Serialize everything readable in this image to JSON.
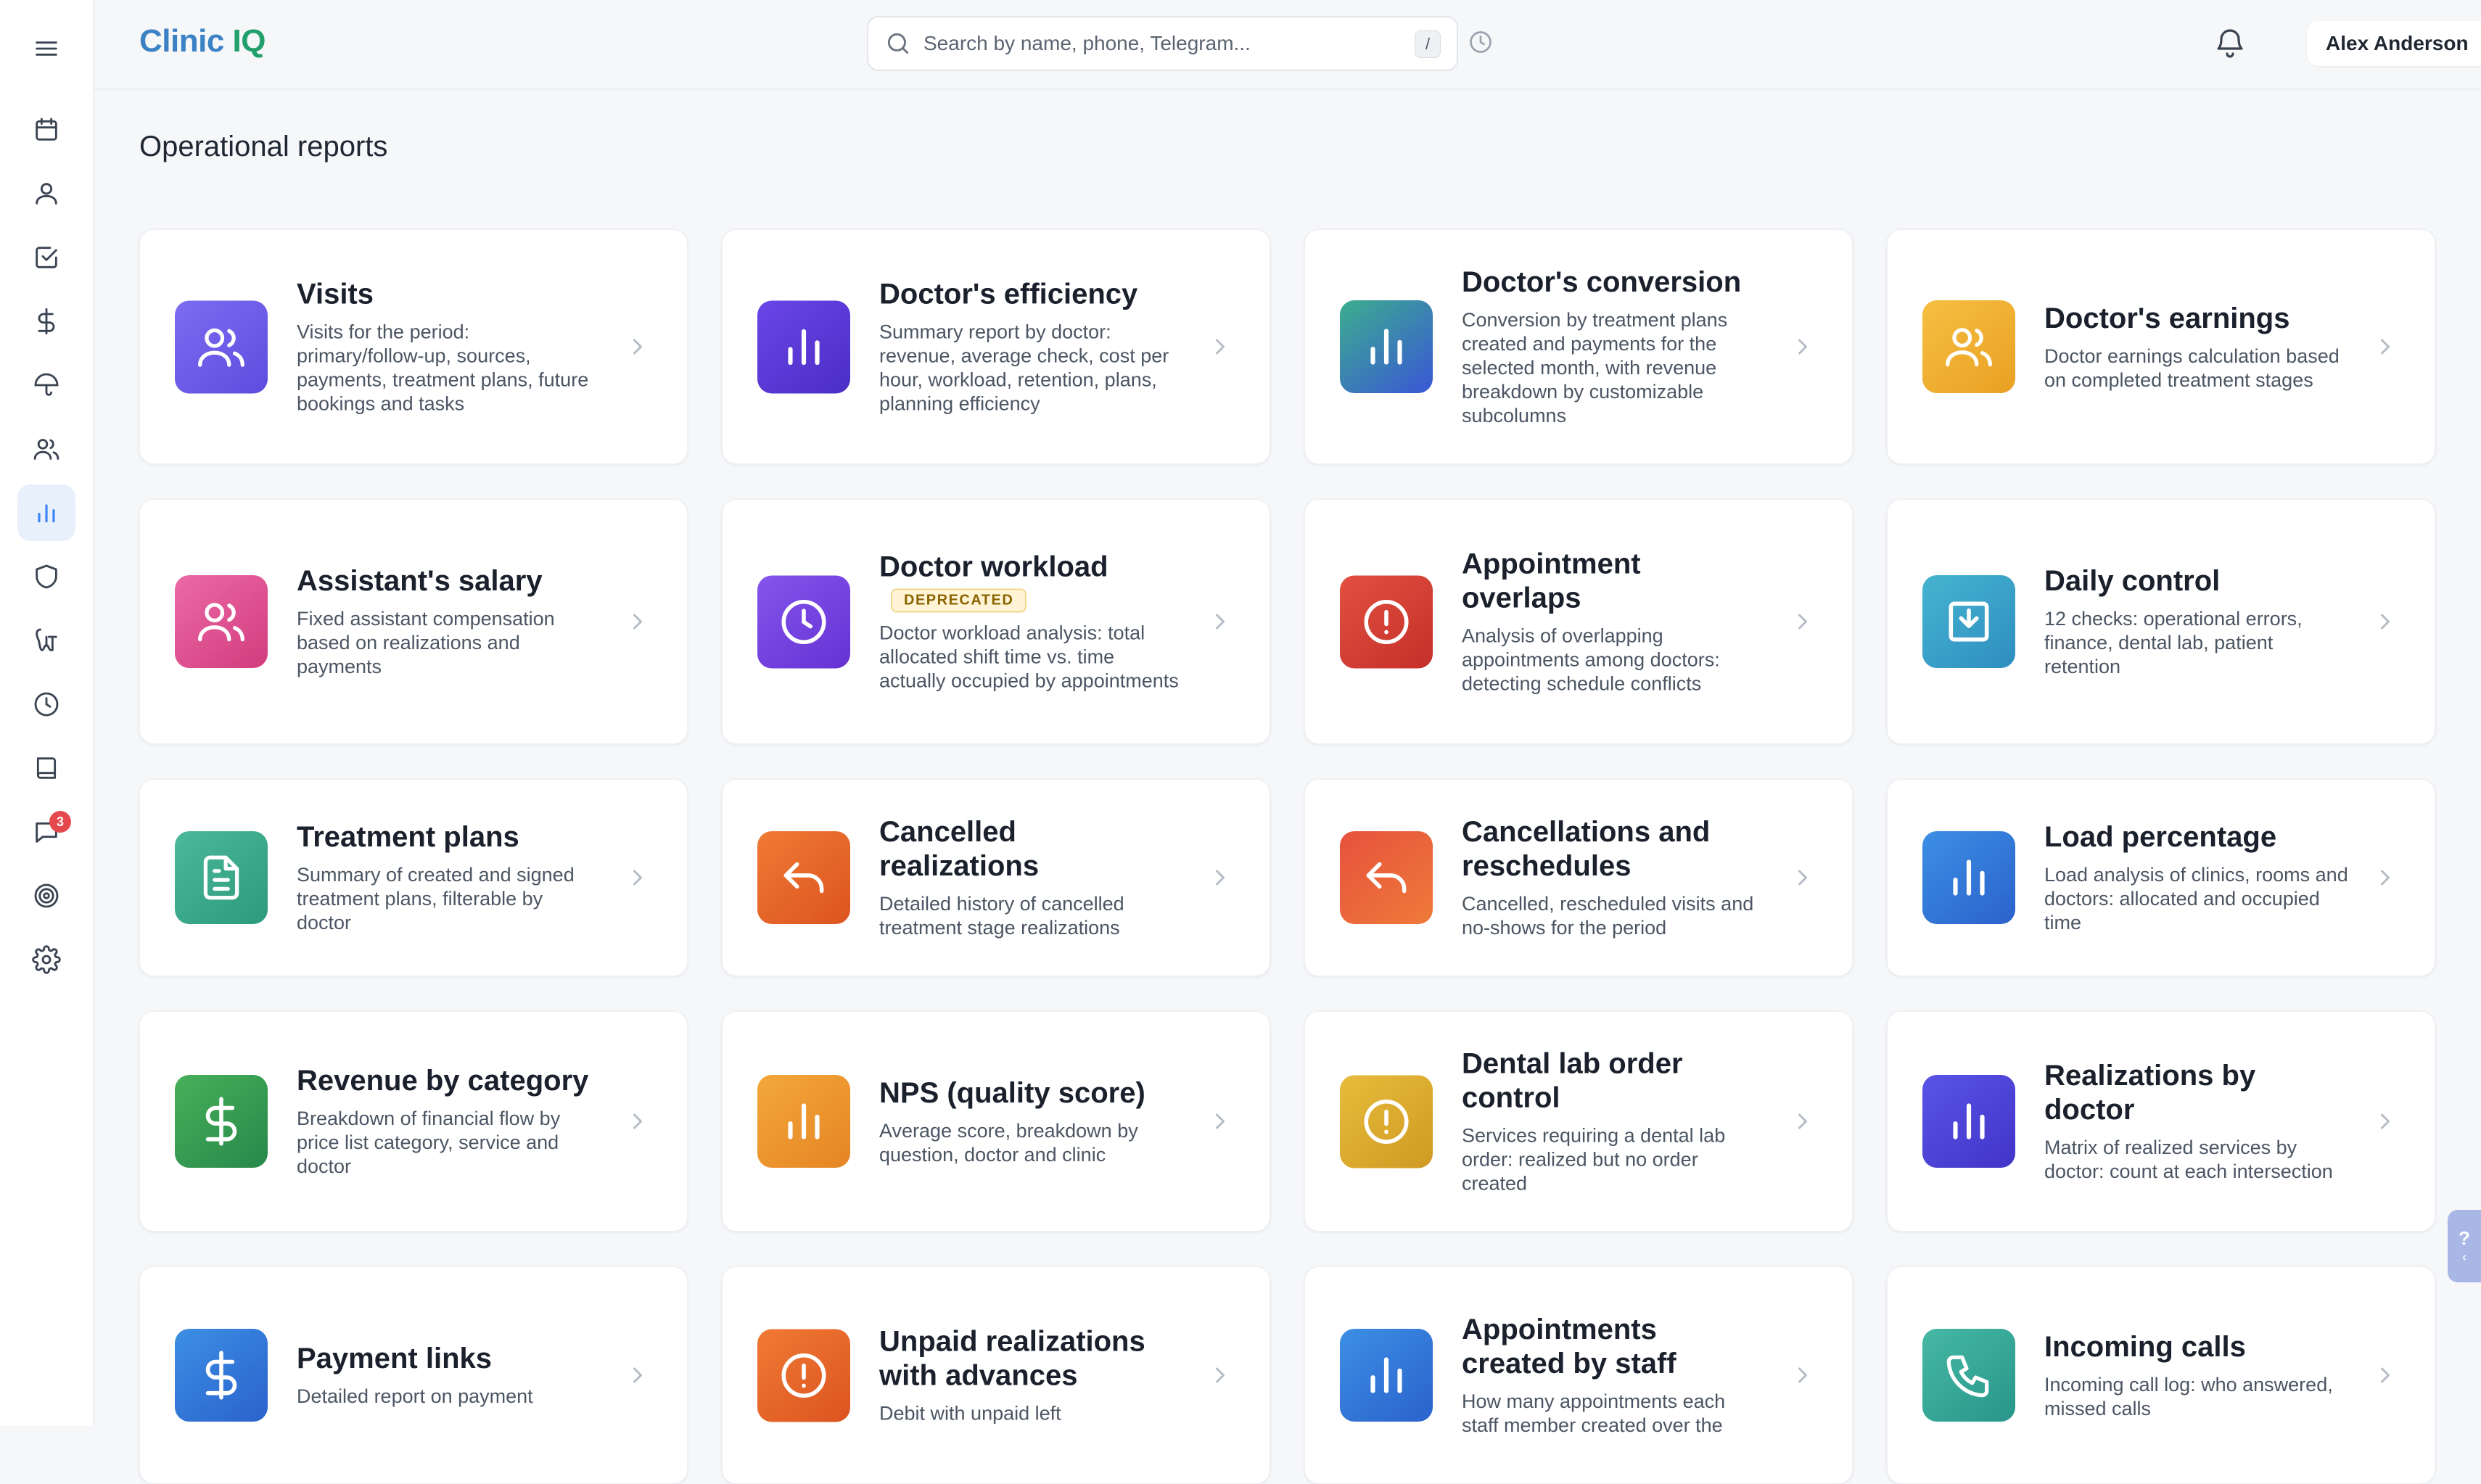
{
  "app": {
    "logo_part1": "Clinic",
    "logo_part2": "IQ"
  },
  "search": {
    "placeholder": "Search by name, phone, Telegram...",
    "shortcut": "/"
  },
  "user": {
    "name": "Alex Anderson"
  },
  "sidebar": {
    "items": [
      {
        "icon": "calendar-icon"
      },
      {
        "icon": "person-icon"
      },
      {
        "icon": "checkbox-icon"
      },
      {
        "icon": "dollar-icon"
      },
      {
        "icon": "umbrella-icon"
      },
      {
        "icon": "users-icon"
      },
      {
        "icon": "bar-chart-icon",
        "active": true
      },
      {
        "icon": "shield-icon"
      },
      {
        "icon": "tooth-icon"
      },
      {
        "icon": "clock-icon"
      },
      {
        "icon": "book-icon"
      },
      {
        "icon": "chat-icon",
        "badge": "3"
      },
      {
        "icon": "target-icon"
      },
      {
        "icon": "gear-icon"
      }
    ]
  },
  "page": {
    "title": "Operational reports"
  },
  "reports": [
    {
      "title": "Visits",
      "desc": "Visits for the period: primary/follow-up, sources, payments, treatment plans, future bookings and tasks",
      "icon": "users-icon",
      "color": "violet"
    },
    {
      "title": "Doctor's efficiency",
      "desc": "Summary report by doctor: revenue, average check, cost per hour, workload, retention, plans, planning efficiency",
      "icon": "bar-chart-icon",
      "color": "deep-violet"
    },
    {
      "title": "Doctor's conversion",
      "desc": "Conversion by treatment plans created and payments for the selected month, with revenue breakdown by customizable subcolumns",
      "icon": "bar-chart-icon",
      "color": "teal-blue"
    },
    {
      "title": "Doctor's earnings",
      "desc": "Doctor earnings calculation based on completed treatment stages",
      "icon": "users-icon",
      "color": "amber"
    },
    {
      "title": "Assistant's salary",
      "desc": "Fixed assistant compensation based on realizations and payments",
      "icon": "users-icon",
      "color": "pink"
    },
    {
      "title": "Doctor workload",
      "badge": "DEPRECATED",
      "desc": "Doctor workload analysis: total allocated shift time vs. time actually occupied by appointments",
      "icon": "clock-icon",
      "color": "purple"
    },
    {
      "title": "Appointment overlaps",
      "desc": "Analysis of overlapping appointments among doctors: detecting schedule conflicts",
      "icon": "alert-icon",
      "color": "red"
    },
    {
      "title": "Daily control",
      "desc": "12 checks: operational errors, finance, dental lab, patient retention",
      "icon": "check-square-icon",
      "color": "cyan"
    },
    {
      "title": "Treatment plans",
      "desc": "Summary of created and signed treatment plans, filterable by doctor",
      "icon": "document-icon",
      "color": "green-teal"
    },
    {
      "title": "Cancelled realizations",
      "desc": "Detailed history of cancelled treatment stage realizations",
      "icon": "undo-icon",
      "color": "orange"
    },
    {
      "title": "Cancellations and reschedules",
      "desc": "Cancelled, rescheduled visits and no-shows for the period",
      "icon": "undo-icon",
      "color": "red-orange"
    },
    {
      "title": "Load percentage",
      "desc": "Load analysis of clinics, rooms and doctors: allocated and occupied time",
      "icon": "bar-chart-icon",
      "color": "blue"
    },
    {
      "title": "Revenue by category",
      "desc": "Breakdown of financial flow by price list category, service and doctor",
      "icon": "dollar-icon",
      "color": "green"
    },
    {
      "title": "NPS (quality score)",
      "desc": "Average score, breakdown by question, doctor and clinic",
      "icon": "bar-chart-icon",
      "color": "amber-orange"
    },
    {
      "title": "Dental lab order control",
      "desc": "Services requiring a dental lab order: realized but no order created",
      "icon": "alert-icon",
      "color": "gold"
    },
    {
      "title": "Realizations by doctor",
      "desc": "Matrix of realized services by doctor: count at each intersection",
      "icon": "bar-chart-icon",
      "color": "indigo"
    },
    {
      "title": "Payment links",
      "desc": "Detailed report on payment",
      "icon": "dollar-icon",
      "color": "blue"
    },
    {
      "title": "Unpaid realizations with advances",
      "desc": "Debit with unpaid left",
      "icon": "alert-icon",
      "color": "orange"
    },
    {
      "title": "Appointments created by staff",
      "desc": "How many appointments each staff member created over the",
      "icon": "bar-chart-icon",
      "color": "blue"
    },
    {
      "title": "Incoming calls",
      "desc": "Incoming call log: who answered, missed calls",
      "icon": "phone-icon",
      "color": "teal"
    }
  ],
  "colors": {
    "violet": [
      "#7c6cf0",
      "#5d4de0"
    ],
    "deep-violet": [
      "#6a45e8",
      "#4a2ec4"
    ],
    "teal-blue": [
      "#3cae8e",
      "#3a56d6"
    ],
    "amber": [
      "#f6bf42",
      "#e9a022"
    ],
    "pink": [
      "#ec6aa6",
      "#d23c7e"
    ],
    "purple": [
      "#8554ec",
      "#6532d3"
    ],
    "red": [
      "#e35040",
      "#c4302a"
    ],
    "cyan": [
      "#46b4d0",
      "#2e8ec0"
    ],
    "green-teal": [
      "#4cb89a",
      "#2c9a7c"
    ],
    "orange": [
      "#f07a34",
      "#dc5420"
    ],
    "red-orange": [
      "#e6523c",
      "#ef7a3a"
    ],
    "blue": [
      "#3d8fe4",
      "#2a62cc"
    ],
    "green": [
      "#47b05a",
      "#27884a"
    ],
    "amber-orange": [
      "#f3a83a",
      "#e58424"
    ],
    "gold": [
      "#e8bc3c",
      "#cf9a22"
    ],
    "indigo": [
      "#5a54e6",
      "#4134c8"
    ],
    "teal": [
      "#46b8a4",
      "#28968a"
    ]
  }
}
